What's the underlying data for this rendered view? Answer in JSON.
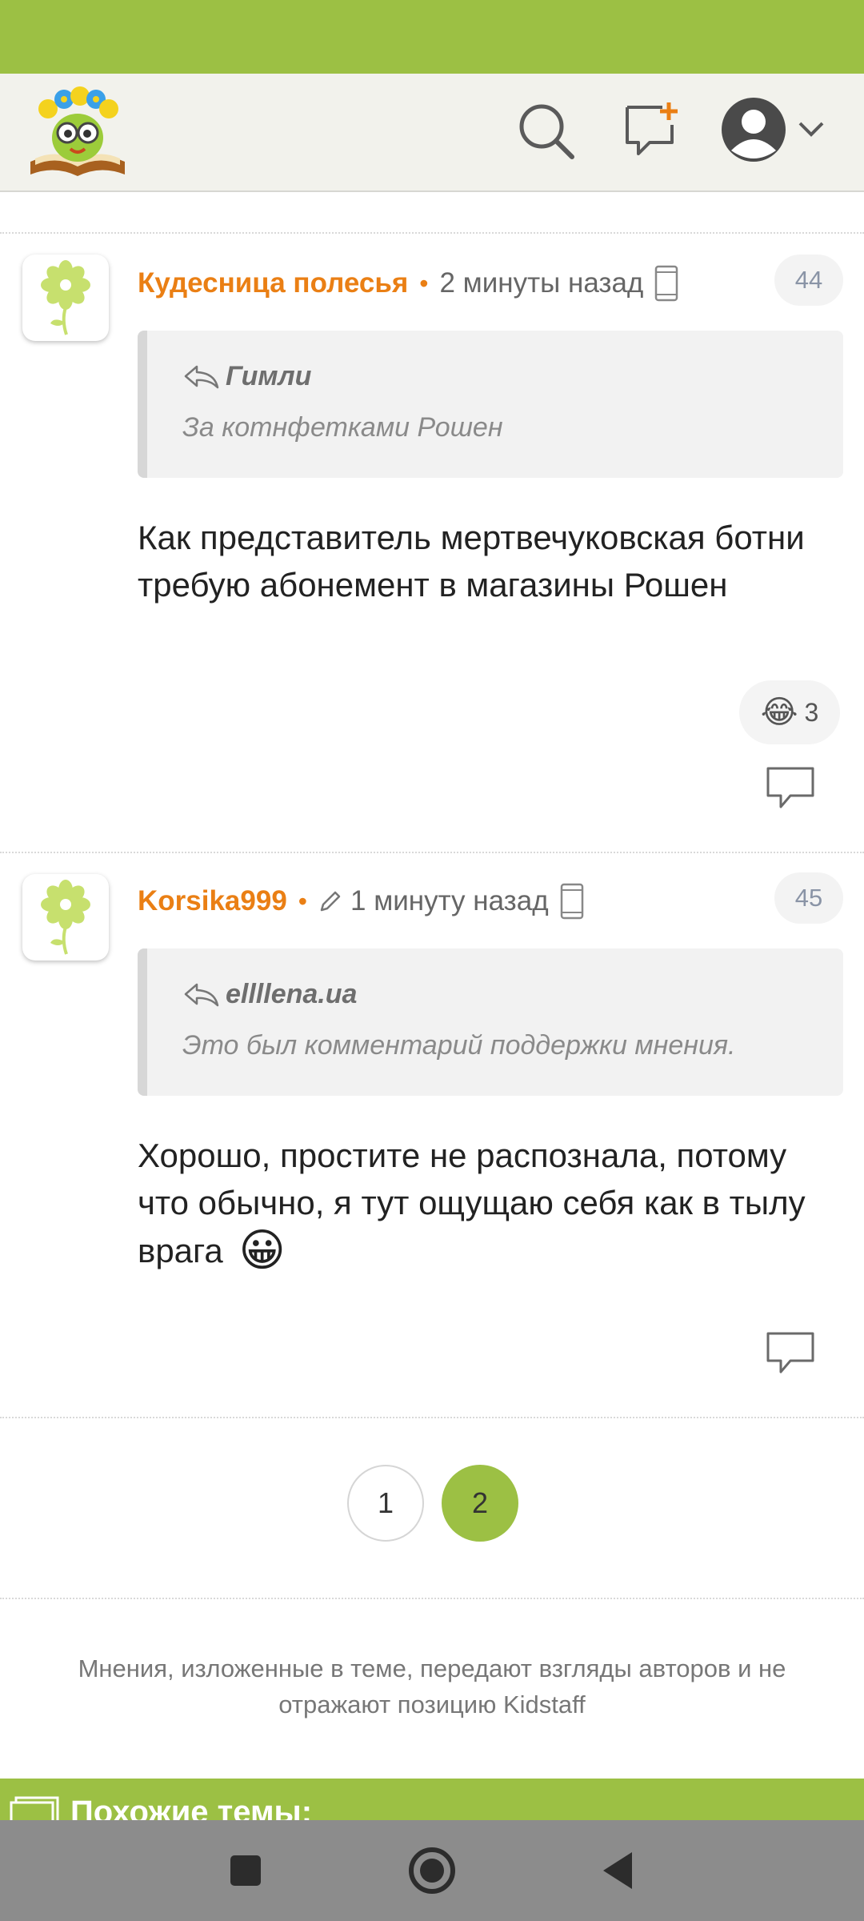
{
  "header": {
    "logo_icon": "kidstaff-logo-icon",
    "icons": [
      "search-icon",
      "new-topic-icon",
      "account-avatar-icon",
      "chevron-down-icon"
    ]
  },
  "comments": [
    {
      "author": "Кудесница полесья",
      "edited": false,
      "time": "2 минуты назад",
      "device_icon": "phone-icon",
      "number": "44",
      "quote": {
        "author": "Гимли",
        "text": "За котнфетками Рошен"
      },
      "body": "Как представитель мертвечуковская ботни требую абонемент в магазины Рошен",
      "reaction": {
        "emoji": "😂",
        "count": "3"
      }
    },
    {
      "author": "Korsika999",
      "edited": true,
      "time": "1 минуту назад",
      "device_icon": "phone-icon",
      "number": "45",
      "quote": {
        "author": "ellllena.ua",
        "text": "Это был комментарий поддержки мнения."
      },
      "body": "Хорошо, простите не распознала, потому что обычно, я тут ощущаю себя как в тылу врага",
      "body_emoji": "😀"
    }
  ],
  "pagination": {
    "pages": [
      "1",
      "2"
    ],
    "current": "2"
  },
  "disclaimer": "Мнения, изложенные в теме, передают взгляды авторов и не отражают позицию Kidstaff",
  "similar_topics": {
    "title": "Похожие темы:"
  },
  "colors": {
    "brand_green": "#9cc044",
    "author_orange": "#ea7f14"
  }
}
